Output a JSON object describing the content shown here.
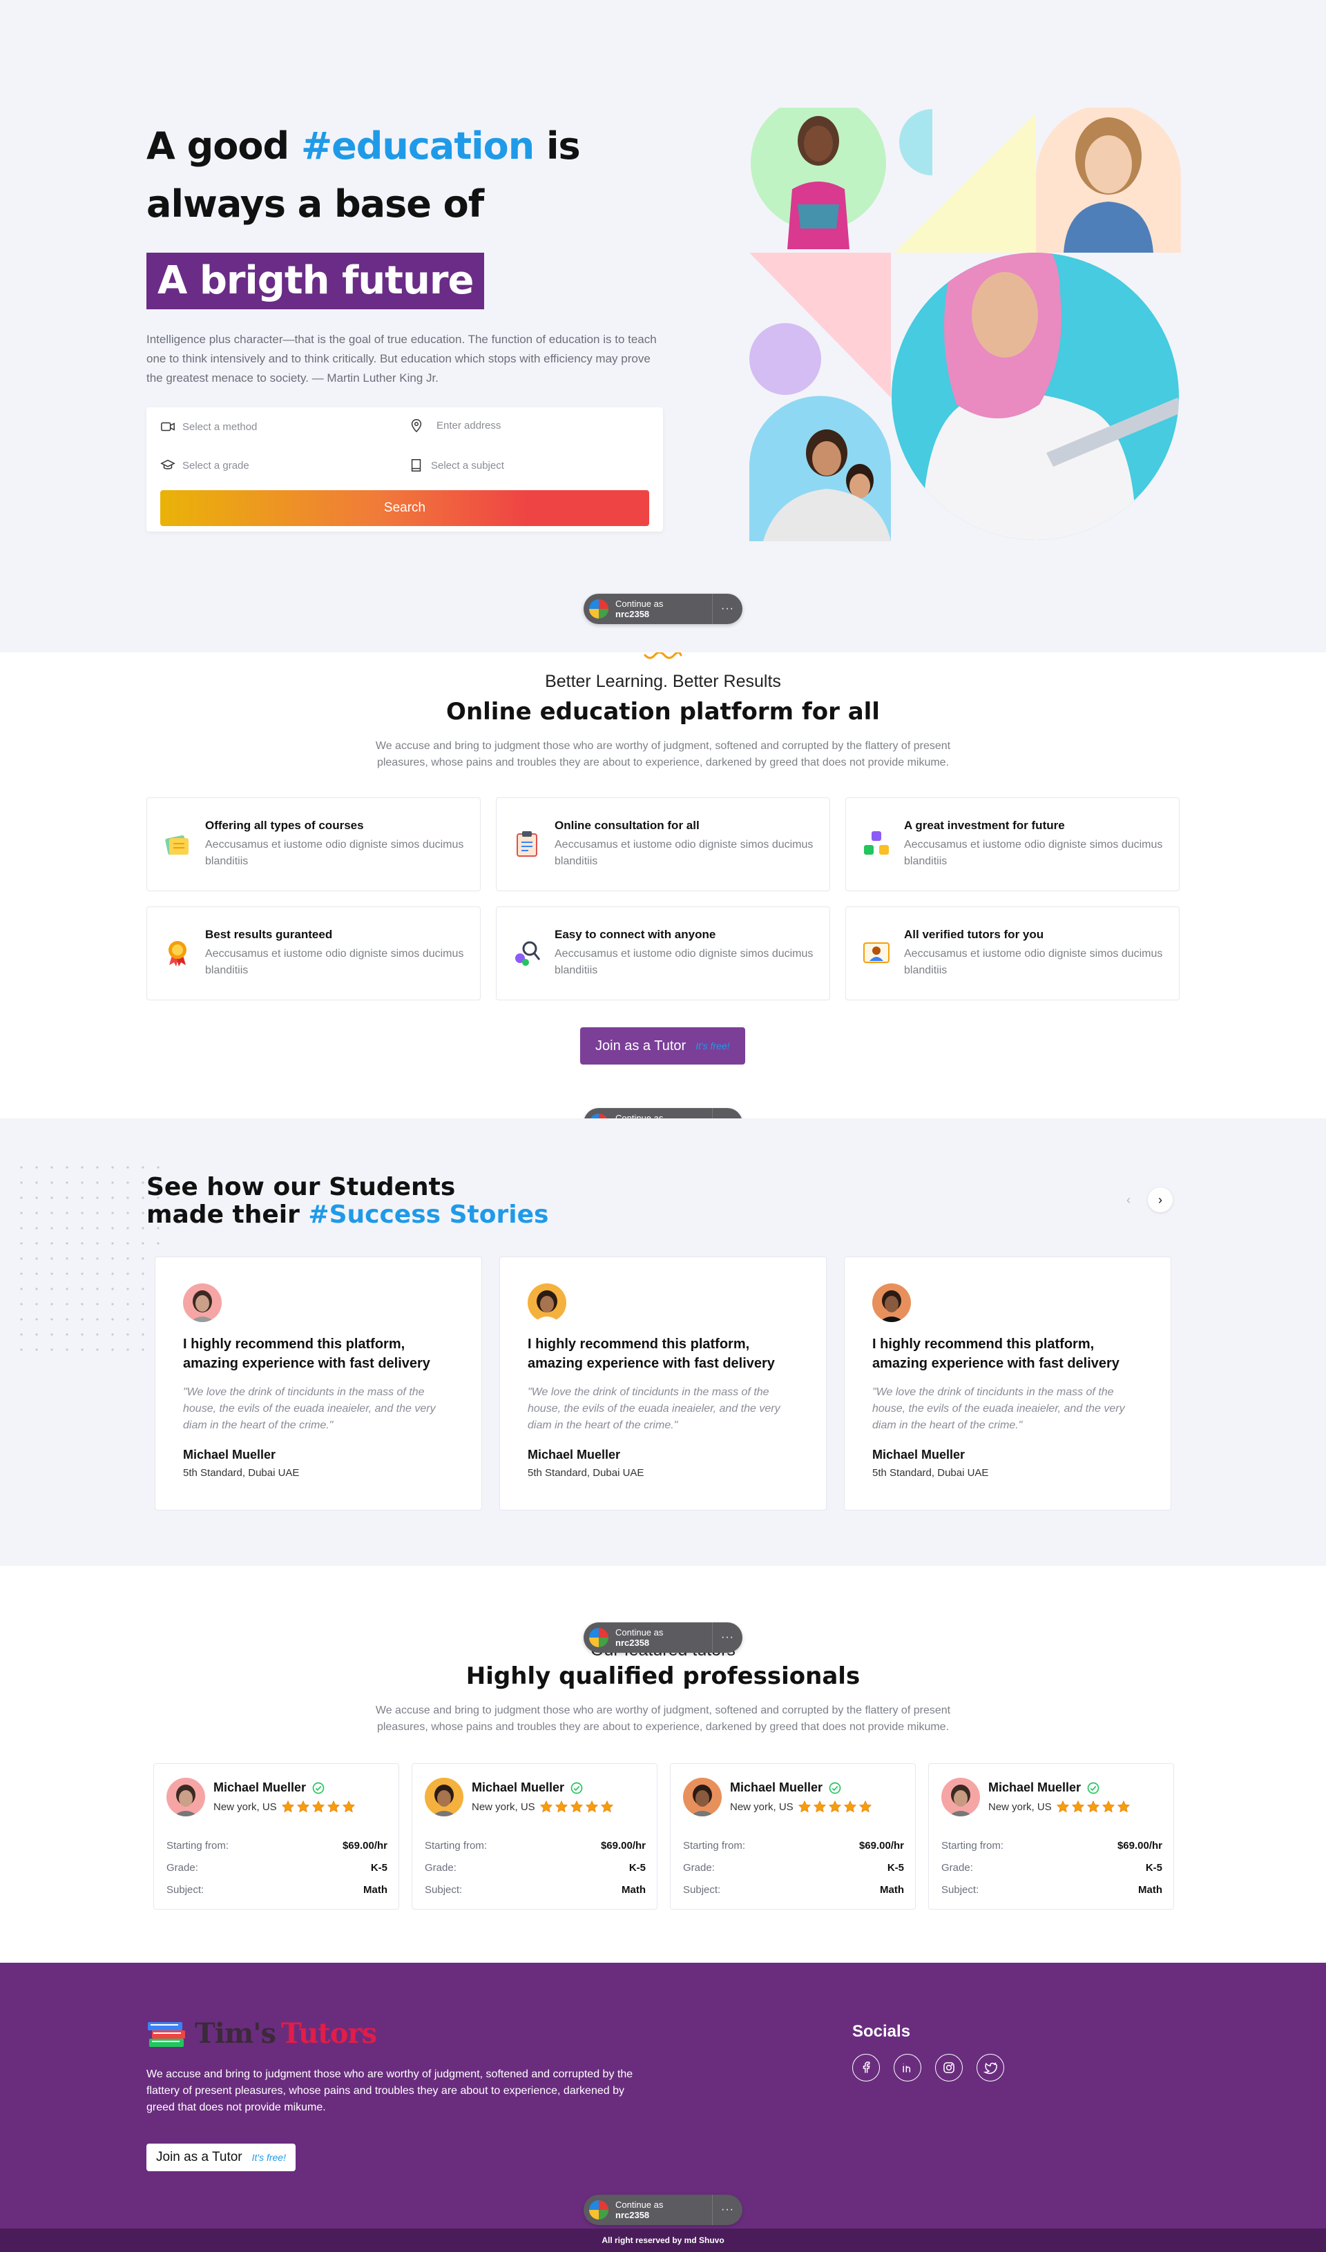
{
  "hero": {
    "title_part1": "A good ",
    "title_accent": "#education",
    "title_part2": " is always a base of",
    "highlight": "A brigth future",
    "quote": "Intelligence plus character—that is the goal of true education. The function of education is to teach one to think intensively and to think critically. But education which stops with efficiency may prove the greatest menace to society. — Martin Luther King Jr.",
    "search": {
      "method_placeholder": "Select a method",
      "address_placeholder": "Enter address",
      "grade_placeholder": "Select a grade",
      "subject_placeholder": "Select a subject",
      "button_label": "Search"
    }
  },
  "continue_pill": {
    "line1": "Continue as",
    "user": "nrc2358",
    "more": "···"
  },
  "features": {
    "kicker": "Better Learning. Better Results",
    "title": "Online education platform for all",
    "description": "We accuse and bring to judgment those who are worthy of judgment, softened and corrupted by the flattery of present pleasures, whose pains and troubles they are about to experience, darkened by greed that does not provide mikume.",
    "items": [
      {
        "title": "Offering all types of courses",
        "desc": "Aeccusamus et iustome odio digniste simos ducimus blanditiis",
        "icon": "books-icon"
      },
      {
        "title": "Online consultation for all",
        "desc": "Aeccusamus et iustome odio digniste simos ducimus blanditiis",
        "icon": "clipboard-icon"
      },
      {
        "title": "A great investment for future",
        "desc": "Aeccusamus et iustome odio digniste simos ducimus blanditiis",
        "icon": "blocks-icon"
      },
      {
        "title": "Best results guranteed",
        "desc": "Aeccusamus et iustome odio digniste simos ducimus blanditiis",
        "icon": "medal-icon"
      },
      {
        "title": "Easy to connect with anyone",
        "desc": "Aeccusamus et iustome odio digniste simos ducimus blanditiis",
        "icon": "network-icon"
      },
      {
        "title": "All verified tutors for you",
        "desc": "Aeccusamus et iustome odio digniste simos ducimus blanditiis",
        "icon": "certificate-icon"
      }
    ],
    "join_label": "Join as a Tutor",
    "join_badge": "It's free!"
  },
  "stories": {
    "title_line1": "See how our Students",
    "title_line2_prefix": "made their ",
    "title_accent": "#Success Stories",
    "cards": [
      {
        "headline": "I highly recommend this platform, amazing experience with fast delivery",
        "quote": "\"We love the drink of tincidunts in the mass of the house, the evils of the euada ineaieler, and the very diam in the heart of the crime.\"",
        "name": "Michael Mueller",
        "sub": "5th Standard, Dubai UAE"
      },
      {
        "headline": "I highly recommend this platform, amazing experience with fast delivery",
        "quote": "\"We love the drink of tincidunts in the mass of the house, the evils of the euada ineaieler, and the very diam in the heart of the crime.\"",
        "name": "Michael Mueller",
        "sub": "5th Standard, Dubai UAE"
      },
      {
        "headline": "I highly recommend this platform, amazing experience with fast delivery",
        "quote": "\"We love the drink of tincidunts in the mass of the house, the evils of the euada ineaieler, and the very diam in the heart of the crime.\"",
        "name": "Michael Mueller",
        "sub": "5th Standard, Dubai UAE"
      }
    ]
  },
  "tutors": {
    "kicker": "Our featured tutors",
    "title": "Highly qualified professionals",
    "description": "We accuse and bring to judgment those who are worthy of judgment, softened and corrupted by the flattery of present pleasures, whose pains and troubles they are about to experience, darkened by greed that does not provide mikume.",
    "labels": {
      "starting": "Starting from:",
      "grade": "Grade:",
      "subject": "Subject:"
    },
    "cards": [
      {
        "name": "Michael Mueller",
        "location": "New york, US",
        "rating": 5,
        "price": "$69.00/hr",
        "grade": "K-5",
        "subject": "Math"
      },
      {
        "name": "Michael Mueller",
        "location": "New york, US",
        "rating": 5,
        "price": "$69.00/hr",
        "grade": "K-5",
        "subject": "Math"
      },
      {
        "name": "Michael Mueller",
        "location": "New york, US",
        "rating": 5,
        "price": "$69.00/hr",
        "grade": "K-5",
        "subject": "Math"
      },
      {
        "name": "Michael Mueller",
        "location": "New york, US",
        "rating": 5,
        "price": "$69.00/hr",
        "grade": "K-5",
        "subject": "Math"
      }
    ]
  },
  "footer": {
    "logo_part1": "Tim's",
    "logo_part2": "Tutors",
    "description": "We accuse and bring to judgment those who are worthy of judgment, softened and corrupted by the flattery of present pleasures, whose pains and troubles they are about to experience, darkened by greed that does not provide mikume.",
    "join_label": "Join as a Tutor",
    "join_badge": "It's free!",
    "socials_title": "Socials",
    "socials": [
      "facebook-icon",
      "linkedin-icon",
      "instagram-icon",
      "twitter-icon"
    ],
    "copyright": "All right reserved by md Shuvo"
  },
  "colors": {
    "brand_purple": "#6a2c86",
    "accent_blue": "#1f9ae8",
    "search_gradient_start": "#eab308",
    "search_gradient_end": "#ef4444"
  }
}
